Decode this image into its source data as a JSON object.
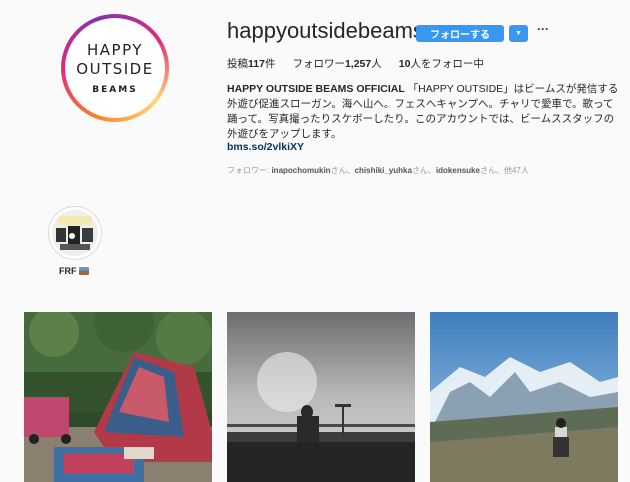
{
  "profile": {
    "avatar_logo": {
      "line1": "HAPPY",
      "line2": "OUTSIDE",
      "line3": "BEAMS"
    },
    "username": "happyoutsidebeams",
    "follow_label": "フォローする",
    "dropdown_icon": "caret-down-icon",
    "more_label": "···",
    "stats": {
      "posts": {
        "prefix": "投稿",
        "value": "117",
        "suffix": "件"
      },
      "followers": {
        "prefix": "フォロワー",
        "value": "1,257",
        "suffix": "人"
      },
      "following": {
        "prefix": "",
        "value": "10",
        "suffix": "人をフォロー中"
      }
    },
    "bio": {
      "name": "HAPPY OUTSIDE BEAMS OFFICIAL",
      "text": " 「HAPPY OUTSIDE」はビームスが発信する外遊び促進スローガン。海へ山へ。フェスへキャンプへ。チャリで愛車で。歌って踊って。写真撮ったりスケボーしたり。このアカウントでは、ビームススタッフの外遊びをアップします。",
      "link": "bms.so/2vlkiXY"
    },
    "followed_by": {
      "label": "フォロワー: ",
      "users": [
        "inapochomukin",
        "chishiki_yuhka",
        "idokensuke"
      ],
      "honorific": "さん、",
      "last_honorific": "さん、",
      "others": "他47人"
    }
  },
  "highlights": [
    {
      "label": "FRF",
      "icon": "mountain-emoji-icon"
    }
  ],
  "posts": [
    {
      "name": "camping-tent-photo"
    },
    {
      "name": "silhouette-sky-photo"
    },
    {
      "name": "snow-mountain-photo"
    }
  ],
  "colors": {
    "accent": "#3897f0",
    "link": "#003569",
    "background": "#fafafa"
  }
}
